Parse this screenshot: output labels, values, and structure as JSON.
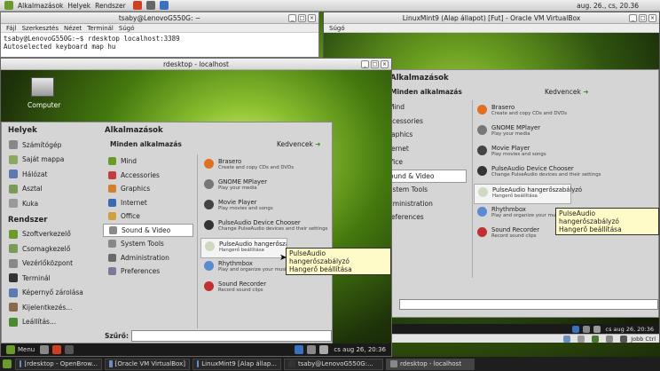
{
  "host_panel": {
    "items": [
      "Alkalmazások",
      "Helyek",
      "Rendszer"
    ],
    "clock": "aug. 26., cs, 20.36"
  },
  "terminal": {
    "title": "tsaby@LenovoG550G: ~",
    "menu": [
      "Fájl",
      "Szerkesztés",
      "Nézet",
      "Terminál",
      "Súgó"
    ],
    "lines": [
      "tsaby@LenovoG550G:~$ rdesktop localhost:3389",
      "Autoselected keyboard map hu"
    ]
  },
  "vbox": {
    "title": "LinuxMint9 (Alap állapot) [Fut] - Oracle VM VirtualBox",
    "menu": [
      "Súgó"
    ],
    "status_right": "Jobb Ctrl",
    "clock": "cs aug 26, 20:36"
  },
  "rdp": {
    "title": "rdesktop - localhost",
    "desktop_icon": "Computer",
    "panel_menu": "Menu",
    "clock": "cs aug 26, 20:36"
  },
  "menu": {
    "places_title": "Helyek",
    "places": [
      "Számítógép",
      "Saját mappa",
      "Hálózat",
      "Asztal",
      "Kuka"
    ],
    "system_title": "Rendszer",
    "system": [
      "Szoftverkezelő",
      "Csomagkezelő",
      "Vezérlőközpont",
      "Terminál",
      "Képernyő zárolása",
      "Kijelentkezés...",
      "Leállítás..."
    ],
    "apps_title": "Alkalmazások",
    "all_apps": "Minden alkalmazás",
    "favorites": "Kedvencek",
    "categories": [
      "Mind",
      "Accessories",
      "Graphics",
      "Internet",
      "Office",
      "Sound & Video",
      "System Tools",
      "Administration",
      "Preferences"
    ],
    "vb_categories": [
      "Mind",
      "ccessories",
      "raphics",
      "ternet",
      "ffice",
      "ound & Video",
      "ystem Tools",
      "dministration",
      "references"
    ],
    "apps": [
      {
        "name": "Brasero",
        "desc": "Create and copy CDs and DVDs"
      },
      {
        "name": "GNOME MPlayer",
        "desc": "Play your media"
      },
      {
        "name": "Movie Player",
        "desc": "Play movies and songs"
      },
      {
        "name": "PulseAudio Device Chooser",
        "desc": "Change PulseAudio devices and their settings"
      },
      {
        "name": "PulseAudio hangerőszabályzó",
        "desc": "Hangerő beállítása"
      },
      {
        "name": "Rhythmbox",
        "desc": "Play and organize your music collection"
      },
      {
        "name": "Sound Recorder",
        "desc": "Record sound clips"
      }
    ],
    "search_label": "Szűrő:",
    "tooltip_name": "PulseAudio hangerőszabályzó",
    "tooltip_desc": "Hangerő beállítása",
    "rdp_truncated": "PulseAudio hangerőszabályzó"
  },
  "taskbar": {
    "items": [
      "[rdesktop - OpenBrow...",
      "[Oracle VM VirtualBox]",
      "LinuxMint9 [Alap állap...",
      "tsaby@LenovoG550G:...",
      "rdesktop - localhost"
    ]
  }
}
